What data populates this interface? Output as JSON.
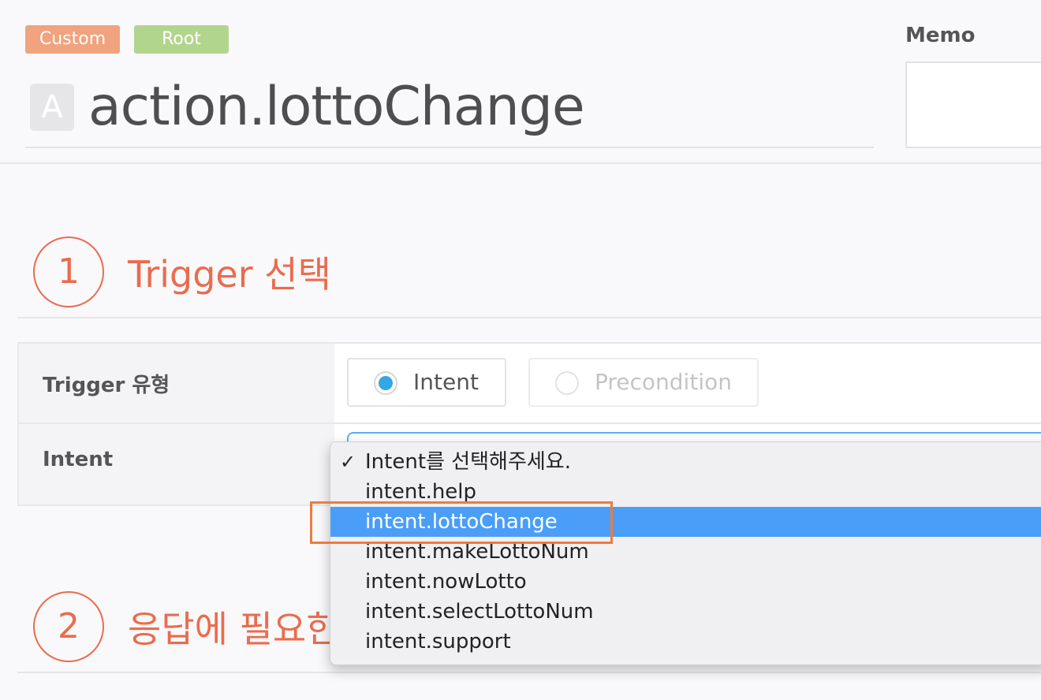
{
  "badges": {
    "custom": "Custom",
    "root": "Root"
  },
  "header": {
    "icon_letter": "A",
    "title": "action.lottoChange"
  },
  "memo": {
    "label": "Memo",
    "value": ""
  },
  "sections": [
    {
      "number": "1",
      "title": "Trigger 선택"
    },
    {
      "number": "2",
      "title": "응답에 필요한"
    }
  ],
  "form": {
    "trigger_type_label": "Trigger 유형",
    "intent_label": "Intent",
    "radio_options": [
      {
        "label": "Intent",
        "checked": true
      },
      {
        "label": "Precondition",
        "checked": false
      }
    ]
  },
  "dropdown": {
    "checked_index": 0,
    "selected_index": 2,
    "options": [
      "Intent를 선택해주세요.",
      "intent.help",
      "intent.lottoChange",
      "intent.makeLottoNum",
      "intent.nowLotto",
      "intent.selectLottoNum",
      "intent.support"
    ]
  },
  "colors": {
    "accent_orange": "#ea6c4e",
    "badge_custom": "#f0a37e",
    "badge_root": "#b2d58e",
    "radio_checked": "#34a7e5",
    "selection_blue": "#4a9ef8",
    "highlight_box": "#ef7a3f"
  }
}
